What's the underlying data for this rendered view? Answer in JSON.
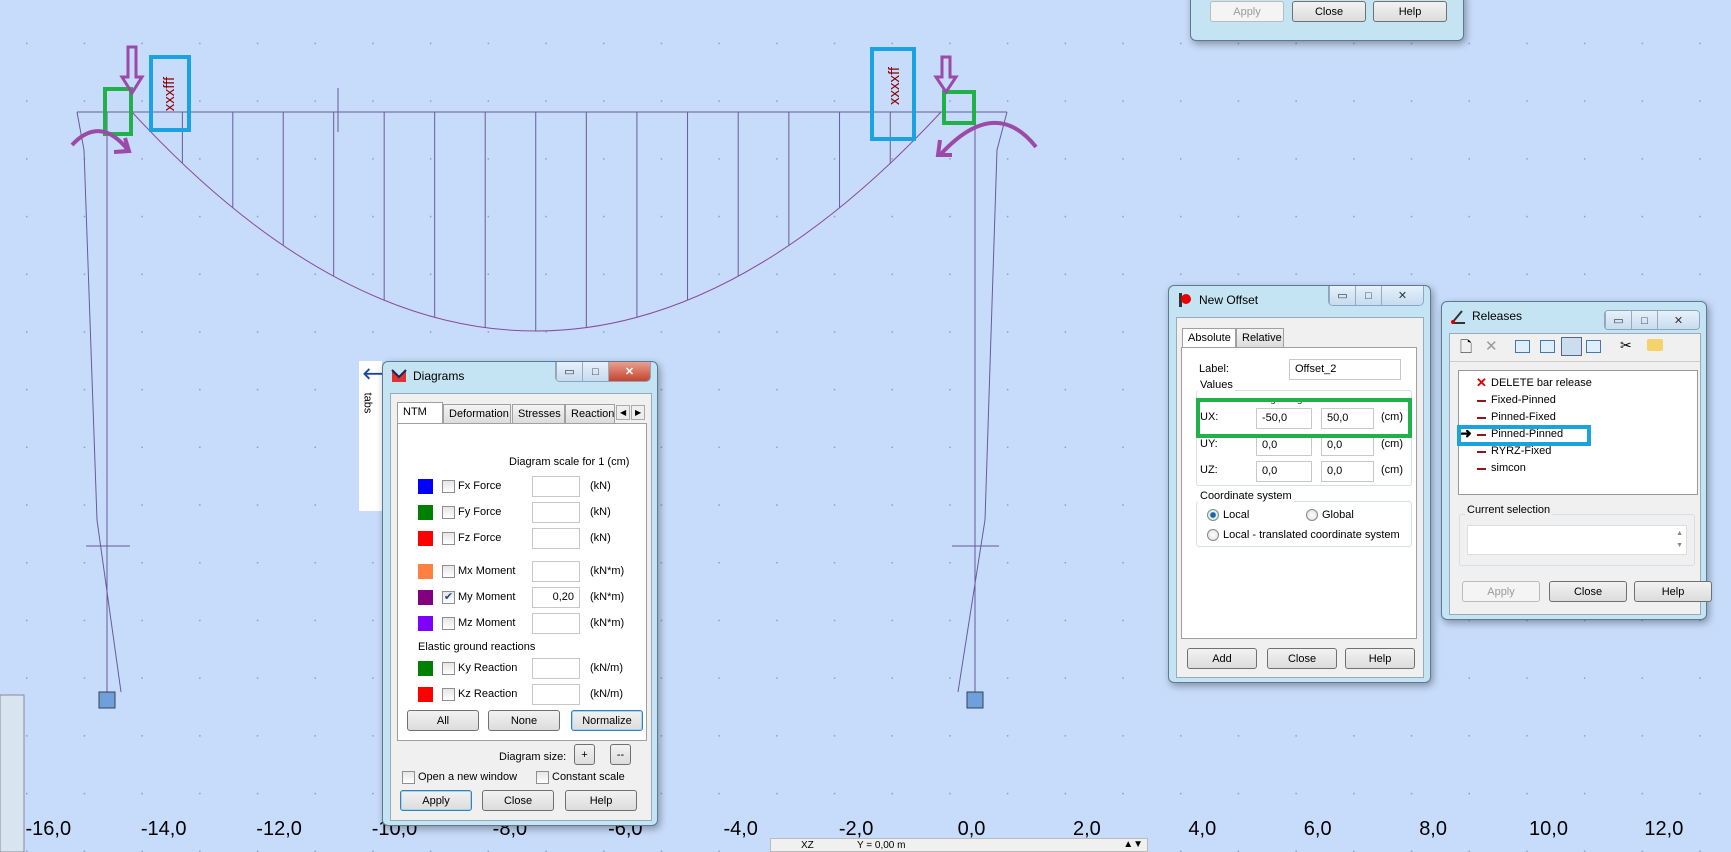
{
  "canvas": {
    "axis_labels": [
      "-16,0",
      "-14,0",
      "-12,0",
      "-10,0",
      "-8,0",
      "-6,0",
      "-4,0",
      "-2,0",
      "0,0",
      "2,0",
      "4,0",
      "6,0",
      "8,0",
      "10,0",
      "12,0"
    ],
    "axis_values": [
      -16,
      -14,
      -12,
      -10,
      -8,
      -6,
      -4,
      -2,
      0,
      2,
      4,
      6,
      8,
      10,
      12
    ],
    "annotation_left": "xxxfff",
    "annotation_right": "xxxxff",
    "colors": {
      "frame": "#6a5a9a",
      "moment": "#8a4aa0",
      "annot_green": "#22b04a",
      "annot_blue": "#1aa3e0",
      "annot_purple": "#9b4aa8",
      "annot_text": "#8b0000"
    }
  },
  "status": {
    "view": "XZ",
    "position": "Y = 0,00 m"
  },
  "top_dialog": {
    "apply": "Apply",
    "close": "Close",
    "help": "Help"
  },
  "tabs_panel": {
    "label": "tabs"
  },
  "diagrams": {
    "title": "Diagrams",
    "tabs": [
      "NTM",
      "Deformation",
      "Stresses",
      "Reactions"
    ],
    "scale_label": "Diagram scale for 1  (cm)",
    "rows": [
      {
        "label": "Fx Force",
        "color": "#0000ff",
        "checked": false,
        "value": "",
        "unit": "(kN)"
      },
      {
        "label": "Fy Force",
        "color": "#008000",
        "checked": false,
        "value": "",
        "unit": "(kN)"
      },
      {
        "label": "Fz Force",
        "color": "#ff0000",
        "checked": false,
        "value": "",
        "unit": "(kN)"
      },
      {
        "label": "Mx Moment",
        "color": "#ff8040",
        "checked": false,
        "value": "",
        "unit": "(kN*m)"
      },
      {
        "label": "My Moment",
        "color": "#800080",
        "checked": true,
        "value": "0,20",
        "unit": "(kN*m)"
      },
      {
        "label": "Mz Moment",
        "color": "#8000ff",
        "checked": false,
        "value": "",
        "unit": "(kN*m)"
      }
    ],
    "elastic_label": "Elastic ground reactions",
    "elastic_rows": [
      {
        "label": "Ky Reaction",
        "color": "#008000",
        "checked": false,
        "value": "",
        "unit": "(kN/m)"
      },
      {
        "label": "Kz Reaction",
        "color": "#ff0000",
        "checked": false,
        "value": "",
        "unit": "(kN/m)"
      }
    ],
    "all": "All",
    "none": "None",
    "normalize": "Normalize",
    "size_label": "Diagram size:",
    "plus": "+",
    "minus": "--",
    "open_new_window": "Open a new window",
    "constant_scale": "Constant scale",
    "apply": "Apply",
    "close": "Close",
    "help": "Help"
  },
  "offset": {
    "title": "New Offset",
    "tabs": [
      "Absolute",
      "Relative"
    ],
    "label_caption": "Label:",
    "label_value": "Offset_2",
    "values_caption": "Values",
    "beginning": "Beginning:",
    "end": "End:",
    "rows": [
      {
        "label": "UX:",
        "begin": "-50,0",
        "end": "50,0",
        "unit": "(cm)"
      },
      {
        "label": "UY:",
        "begin": "0,0",
        "end": "0,0",
        "unit": "(cm)"
      },
      {
        "label": "UZ:",
        "begin": "0,0",
        "end": "0,0",
        "unit": "(cm)"
      }
    ],
    "coord_caption": "Coordinate system",
    "local": "Local",
    "global": "Global",
    "local_translated": "Local - translated coordinate system",
    "selected": "Local",
    "add": "Add",
    "close": "Close",
    "help": "Help"
  },
  "releases": {
    "title": "Releases",
    "items": [
      "DELETE bar release",
      "Fixed-Pinned",
      "Pinned-Fixed",
      "Pinned-Pinned",
      "RYRZ-Fixed",
      "simcon"
    ],
    "selected": "Pinned-Pinned",
    "current_selection": "Current selection",
    "apply": "Apply",
    "close": "Close",
    "help": "Help"
  }
}
